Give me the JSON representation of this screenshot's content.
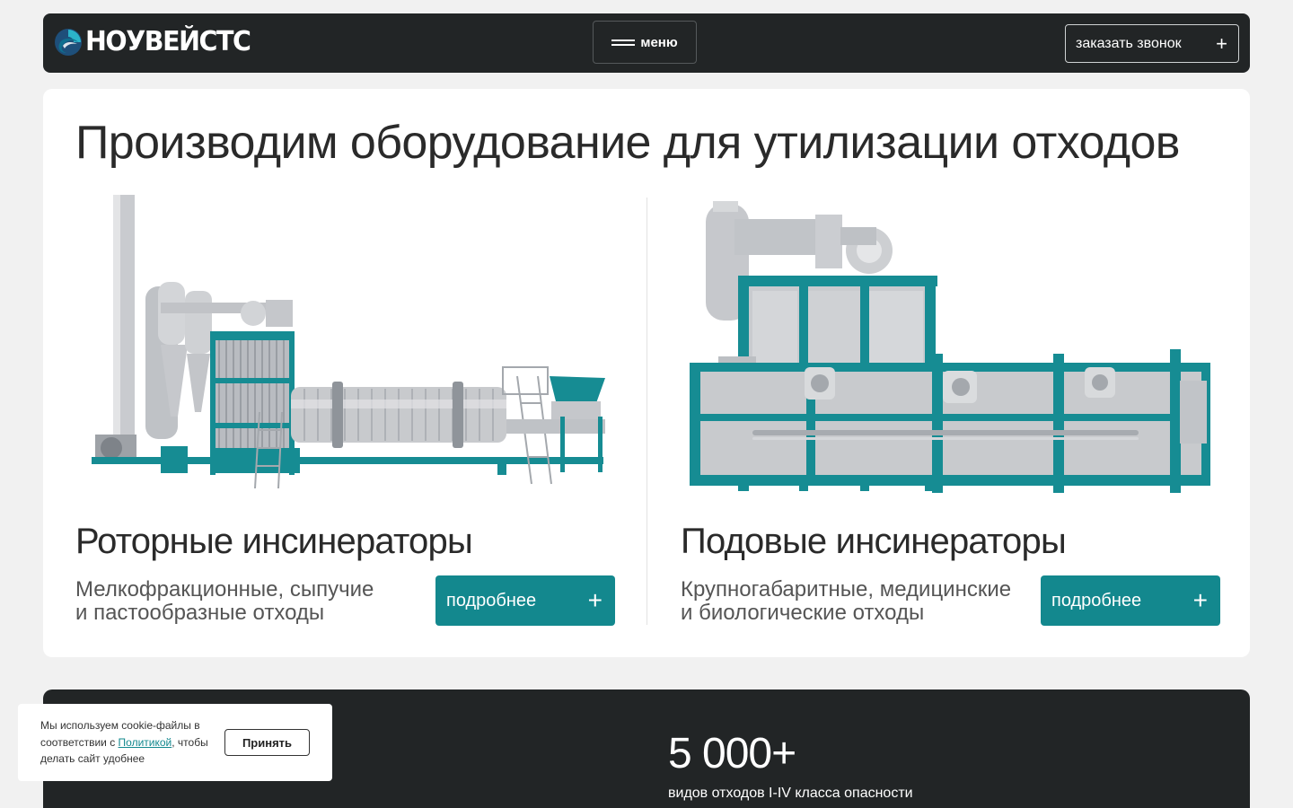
{
  "header": {
    "logo_text": "НОУВЕЙСТС",
    "menu_label": "меню",
    "call_label": "заказать звонок",
    "plus_glyph": "+"
  },
  "hero": {
    "title": "Производим оборудование для утилизации отходов",
    "products": [
      {
        "title": "Роторные инсинераторы",
        "desc_line1": "Мелкофракционные, сыпучие",
        "desc_line2": "и пастообразные отходы",
        "button_label": "подробнее"
      },
      {
        "title": "Подовые инсинераторы",
        "desc_line1": "Крупногабаритные, медицинские",
        "desc_line2": "и биологические отходы",
        "button_label": "подробнее"
      }
    ]
  },
  "stats": {
    "value": "5 000+",
    "label": "видов отходов I-IV класса опасности"
  },
  "cookie": {
    "text_before": "Мы используем cookie-файлы в соответствии с ",
    "link_text": "Политикой",
    "text_after": ", чтобы делать сайт удобнее",
    "accept_label": "Принять"
  },
  "colors": {
    "header_bg": "#222526",
    "accent_teal": "#13888e",
    "page_bg": "#f1f1f1",
    "card_bg": "#ffffff"
  },
  "icons": [
    "logo-swirl-icon",
    "burger-icon",
    "plus-icon"
  ]
}
